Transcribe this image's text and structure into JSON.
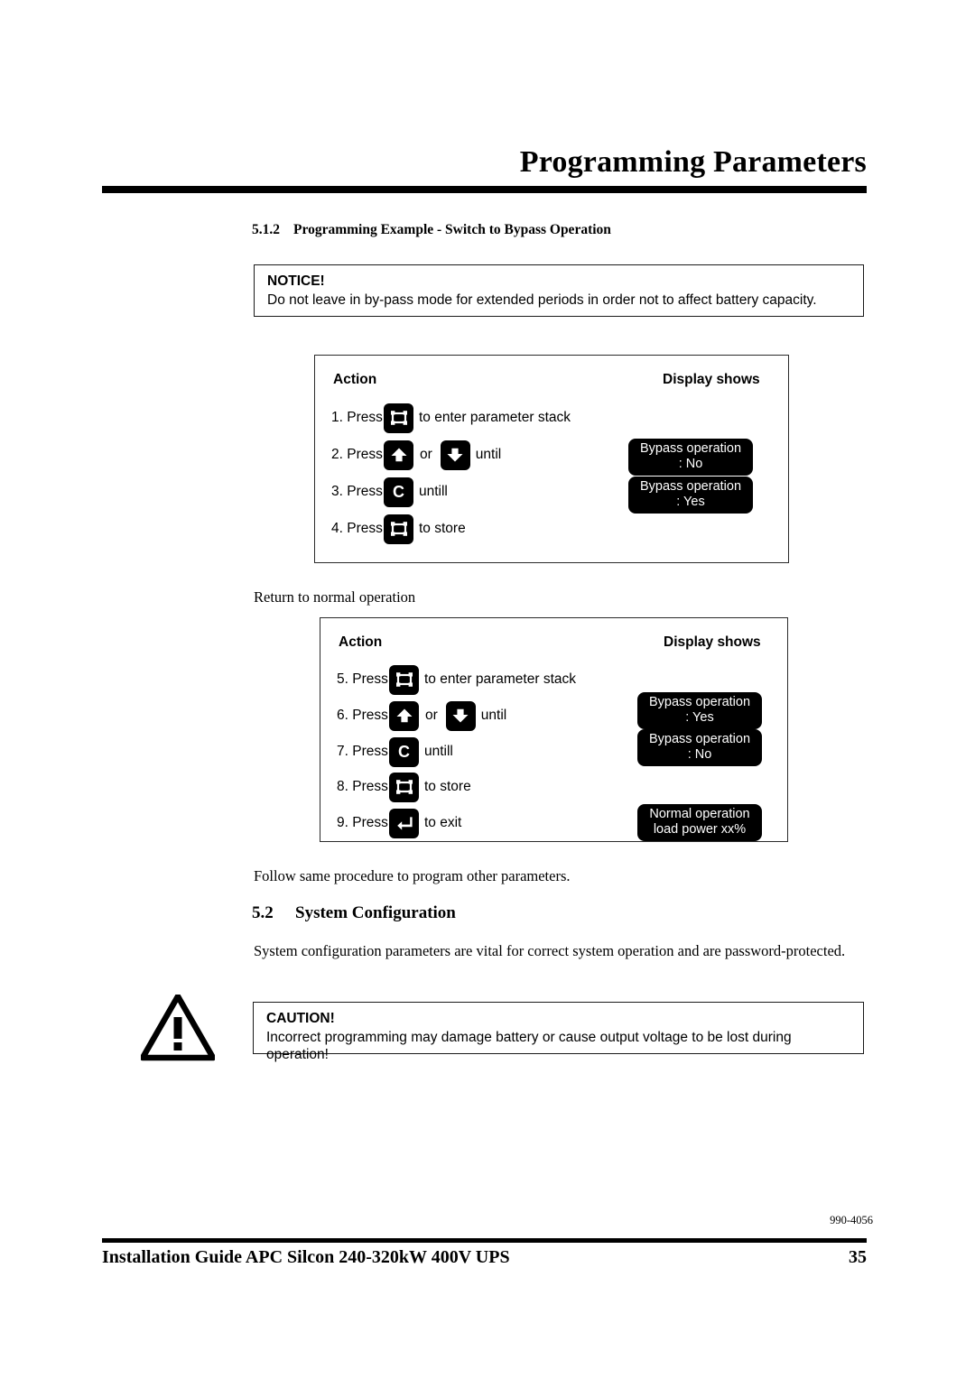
{
  "header": {
    "title": "Programming Parameters"
  },
  "sections": {
    "s512": {
      "number": "5.1.2",
      "title": "Programming Example - Switch to Bypass Operation"
    },
    "s52": {
      "number": "5.2",
      "title": "System Configuration"
    }
  },
  "notice": {
    "title": "NOTICE!",
    "body": "Do not leave in by-pass mode for extended periods in order not to affect battery capacity."
  },
  "caution": {
    "title": "CAUTION!",
    "body": "Incorrect programming may damage battery or cause output voltage to be lost during operation!",
    "icon": "warning-triangle-icon"
  },
  "paragraphs": {
    "return_to_normal": "Return to normal operation",
    "follow_same": "Follow same procedure to program other parameters.",
    "system_config": "System configuration parameters are vital for correct system operation and are password-protected."
  },
  "table1": {
    "col_action": "Action",
    "col_display": "Display shows",
    "steps": [
      {
        "label": "1. Press",
        "key": "frame-key-icon",
        "text": "to enter parameter stack"
      },
      {
        "label": "2. Press",
        "key": "arrow-up-key-icon",
        "conj": "or",
        "key2": "arrow-down-key-icon",
        "text": "until"
      },
      {
        "label": "3. Press",
        "key": "c-key-icon",
        "text": "untill"
      },
      {
        "label": "4. Press",
        "key": "frame-key-icon",
        "text": "to store"
      }
    ],
    "displays": [
      {
        "line1": "Bypass operation",
        "line2": ": No"
      },
      {
        "line1": "Bypass operation",
        "line2": ": Yes"
      }
    ]
  },
  "table2": {
    "col_action": "Action",
    "col_display": "Display shows",
    "steps": [
      {
        "label": "5. Press",
        "key": "frame-key-icon",
        "text": "to enter parameter stack"
      },
      {
        "label": "6. Press",
        "key": "arrow-up-key-icon",
        "conj": "or",
        "key2": "arrow-down-key-icon",
        "text": "until"
      },
      {
        "label": "7. Press",
        "key": "c-key-icon",
        "text": "untill"
      },
      {
        "label": "8. Press",
        "key": "frame-key-icon",
        "text": "to store"
      },
      {
        "label": "9. Press",
        "key": "enter-key-icon",
        "text": "to exit"
      }
    ],
    "displays": [
      {
        "line1": "Bypass operation",
        "line2": ": Yes"
      },
      {
        "line1": "Bypass operation",
        "line2": ": No"
      },
      {
        "line1": "Normal operation",
        "line2": "load power   xx%"
      }
    ]
  },
  "footer": {
    "doc_code": "990-4056",
    "guide_title": "Installation Guide APC Silcon 240-320kW 400V UPS",
    "page_number": "35"
  },
  "colors": {
    "ink": "#000000",
    "paper": "#ffffff",
    "key_bg": "#000000",
    "lcd_bg": "#000000",
    "lcd_text": "#ffffff"
  }
}
